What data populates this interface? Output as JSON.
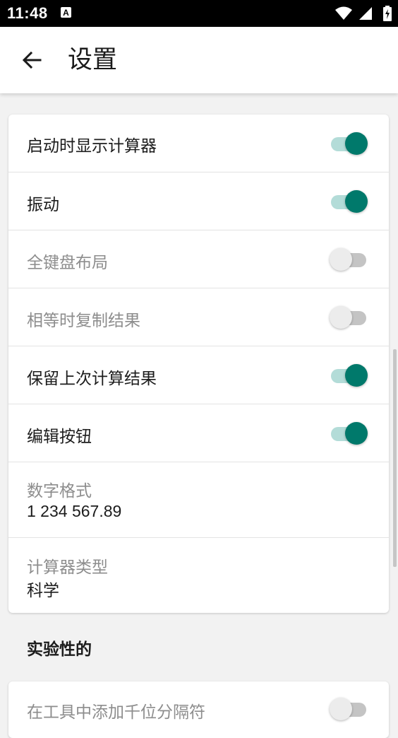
{
  "status_bar": {
    "time": "11:48",
    "notification_letter": "A"
  },
  "app_bar": {
    "title": "设置"
  },
  "settings": [
    {
      "label": "启动时显示计算器",
      "checked": true,
      "enabled": true
    },
    {
      "label": "振动",
      "checked": true,
      "enabled": true
    },
    {
      "label": "全键盘布局",
      "checked": false,
      "enabled": false
    },
    {
      "label": "相等时复制结果",
      "checked": false,
      "enabled": false
    },
    {
      "label": "保留上次计算结果",
      "checked": true,
      "enabled": true
    },
    {
      "label": "编辑按钮",
      "checked": true,
      "enabled": true
    }
  ],
  "number_format": {
    "title": "数字格式",
    "value": "1 234 567.89"
  },
  "calculator_type": {
    "title": "计算器类型",
    "value": "科学"
  },
  "experimental": {
    "header": "实验性的",
    "items": [
      {
        "label": "在工具中添加千位分隔符",
        "checked": false,
        "enabled": false
      }
    ]
  },
  "colors": {
    "accent": "#00796b",
    "accent_track": "#b3dcd8",
    "status_bar": "#000000"
  }
}
